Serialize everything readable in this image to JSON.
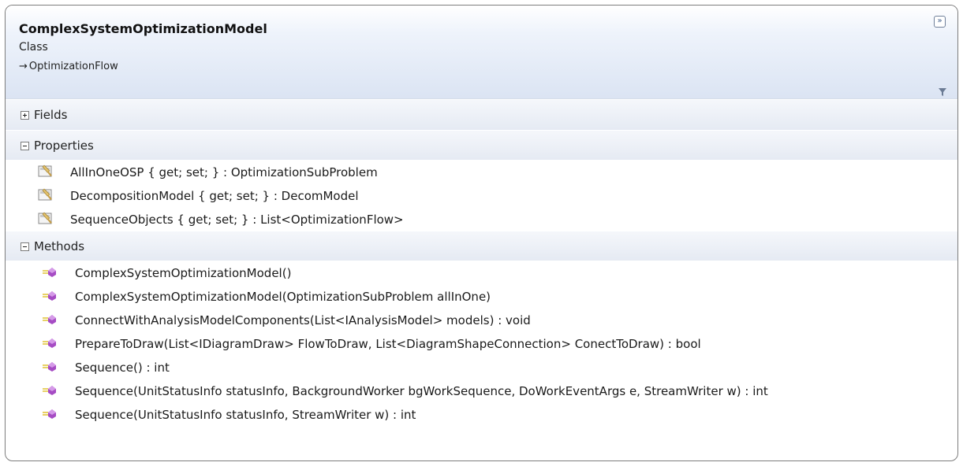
{
  "header": {
    "title": "ComplexSystemOptimizationModel",
    "kind": "Class",
    "base": "OptimizationFlow",
    "collapse_glyph": "»",
    "inherit_arrow": "→"
  },
  "sections": {
    "fields": {
      "label": "Fields"
    },
    "properties": {
      "label": "Properties",
      "items": [
        "AllInOneOSP { get; set; } : OptimizationSubProblem",
        "DecompositionModel { get; set; } : DecomModel",
        "SequenceObjects { get; set; } : List<OptimizationFlow>"
      ]
    },
    "methods": {
      "label": "Methods",
      "items": [
        "ComplexSystemOptimizationModel()",
        "ComplexSystemOptimizationModel(OptimizationSubProblem allInOne)",
        "ConnectWithAnalysisModelComponents(List<IAnalysisModel> models) : void",
        "PrepareToDraw(List<IDiagramDraw> FlowToDraw, List<DiagramShapeConnection> ConectToDraw) : bool",
        "Sequence() : int",
        "Sequence(UnitStatusInfo statusInfo, BackgroundWorker bgWorkSequence, DoWorkEventArgs e, StreamWriter w) : int",
        "Sequence(UnitStatusInfo statusInfo, StreamWriter w) : int"
      ]
    }
  },
  "icons": {
    "property": "property-icon",
    "method": "method-icon",
    "filter": "filter-icon",
    "collapse": "collapse-icon"
  },
  "colors": {
    "header_gradient_bottom": "#dbe4f3",
    "section_gradient_bottom": "#e5eaf3",
    "border": "#7d7d7d",
    "method_icon": "#a64cc4"
  }
}
